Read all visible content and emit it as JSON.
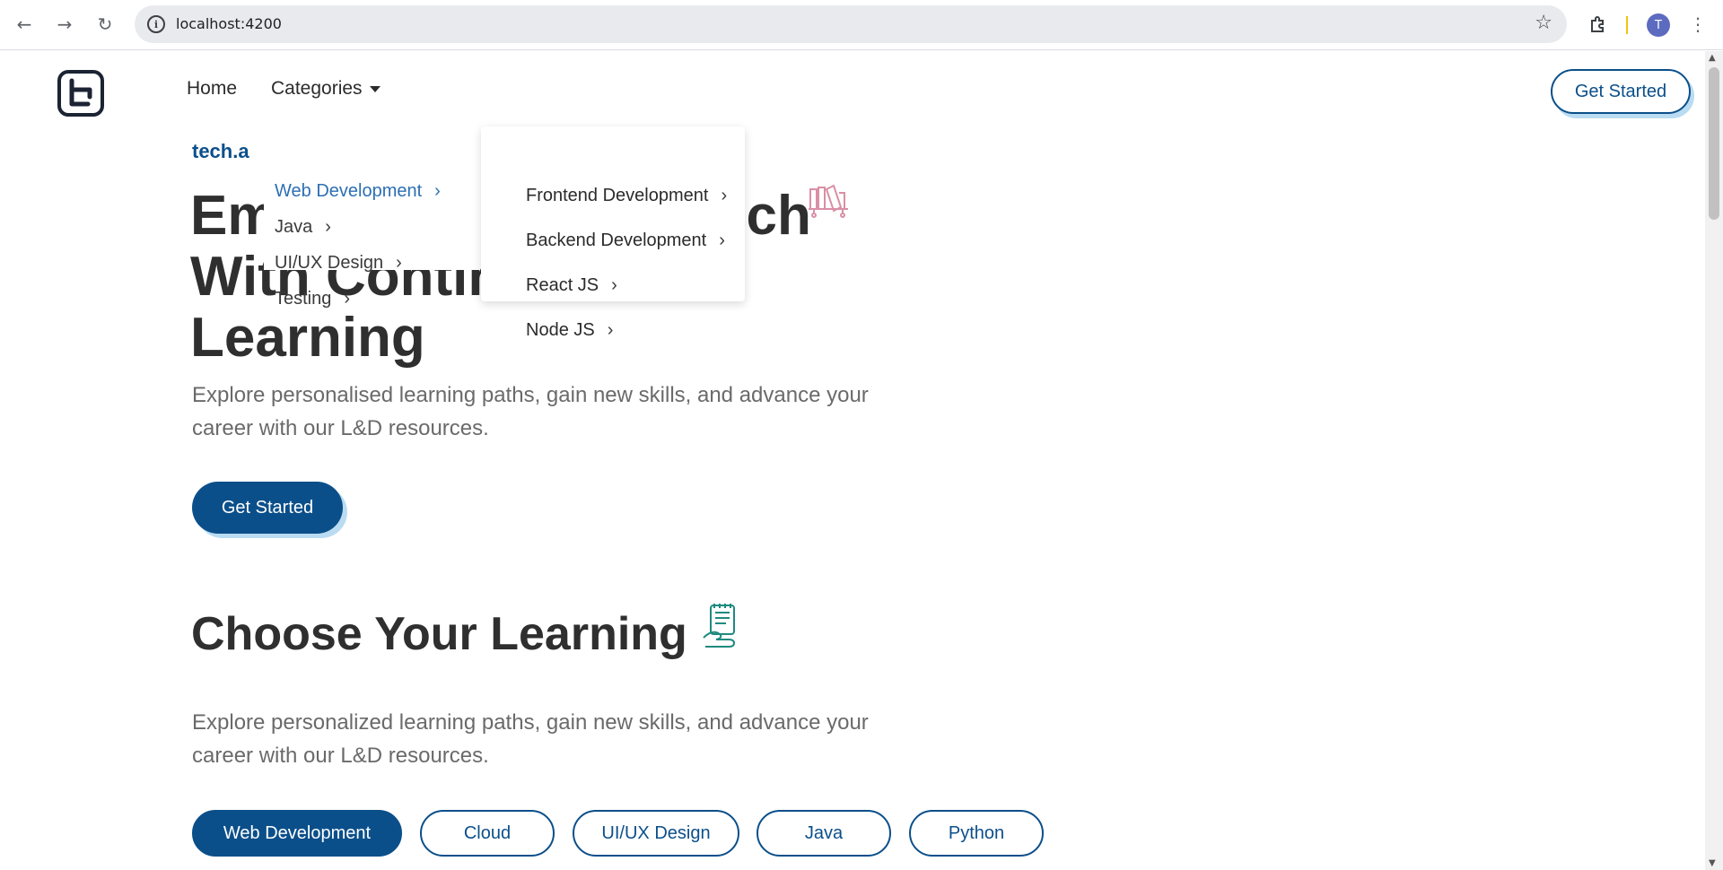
{
  "browser": {
    "url": "localhost:4200",
    "avatar_letter": "T",
    "icons": [
      "back-icon",
      "forward-icon",
      "reload-icon",
      "site-info-icon",
      "star-icon",
      "extensions-icon",
      "menu-icon"
    ]
  },
  "nav": {
    "home": "Home",
    "categories": "Categories",
    "get_started": "Get Started"
  },
  "menu": {
    "level1": [
      "Web Development",
      "Java",
      "UI/UX Design",
      "Testing"
    ],
    "level2": [
      "Frontend Development",
      "Backend Development",
      "React JS",
      "Node JS"
    ]
  },
  "hero": {
    "eyebrow": "tech.a",
    "title_line1_left": "Em",
    "title_line1_right": "ch",
    "title_line2": "With Continuous",
    "title_line3": "Learning",
    "subtitle": "Explore personalised learning paths, gain new skills, and advance your career with our L&D resources.",
    "cta": "Get Started"
  },
  "learning": {
    "title": "Choose Your Learning",
    "subtitle": "Explore personalized learning paths, gain new skills, and advance your career with our L&D resources.",
    "pills": [
      "Web Development",
      "Cloud",
      "UI/UX Design",
      "Java",
      "Python"
    ],
    "active_pill": "Web Development"
  },
  "colors": {
    "primary": "#0b4f8a",
    "accent_shadow": "#b9dcf2",
    "menu_active": "#2d6fb3"
  }
}
